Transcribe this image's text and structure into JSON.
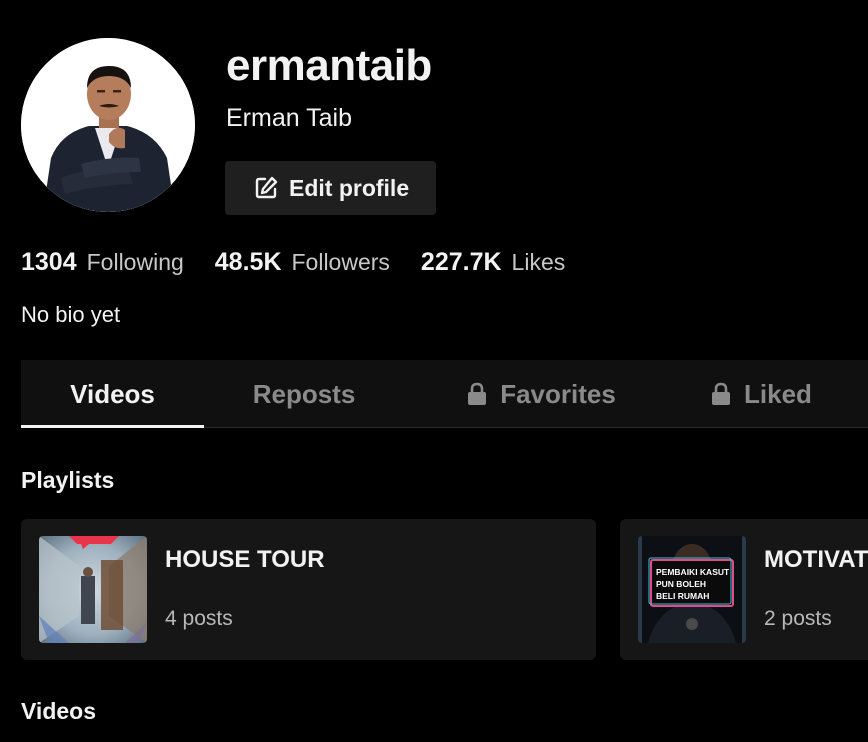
{
  "profile": {
    "username": "ermantaib",
    "display_name": "Erman Taib",
    "edit_label": "Edit profile",
    "bio": "No bio yet"
  },
  "stats": [
    {
      "value": "1304",
      "label": "Following"
    },
    {
      "value": "48.5K",
      "label": "Followers"
    },
    {
      "value": "227.7K",
      "label": "Likes"
    }
  ],
  "tabs": [
    {
      "label": "Videos",
      "locked": false,
      "active": true
    },
    {
      "label": "Reposts",
      "locked": false,
      "active": false
    },
    {
      "label": "Favorites",
      "locked": true,
      "active": false
    },
    {
      "label": "Liked",
      "locked": true,
      "active": false
    }
  ],
  "sections": {
    "playlists_title": "Playlists",
    "videos_title": "Videos"
  },
  "playlists": [
    {
      "title": "HOUSE TOUR",
      "count": "4 posts"
    },
    {
      "title": "MOTIVAT",
      "count": "2 posts",
      "thumb_text": [
        "PEMBAIKI KASUT",
        "PUN BOLEH",
        "BELI RUMAH"
      ]
    }
  ],
  "icons": {
    "edit": "edit-square-icon",
    "lock": "lock-icon"
  },
  "colors": {
    "background": "#000000",
    "tab_bar": "#101010",
    "card": "#161616",
    "button": "#1f1f1f"
  }
}
